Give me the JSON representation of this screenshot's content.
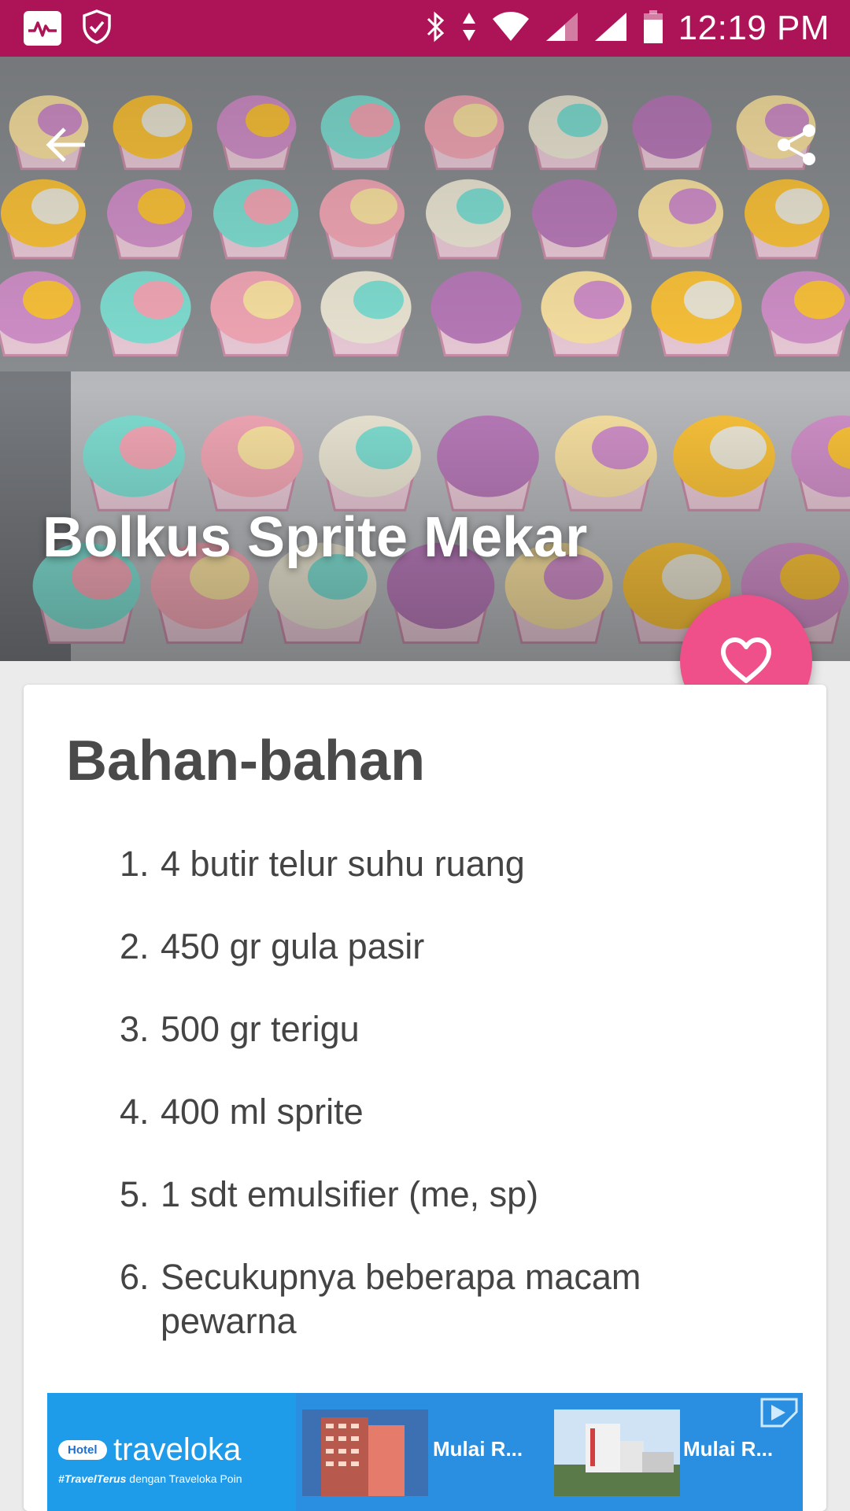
{
  "status_bar": {
    "time": "12:19 PM",
    "background_color": "#ad1457"
  },
  "hero": {
    "title": "Bolkus Sprite Mekar",
    "back_icon": "arrow-left-icon",
    "share_icon": "share-icon"
  },
  "fab": {
    "icon": "heart-outline-icon",
    "color": "#f0508a"
  },
  "ingredients": {
    "heading": "Bahan-bahan",
    "items": [
      {
        "number": "1.",
        "text": "4 butir telur suhu ruang"
      },
      {
        "number": "2.",
        "text": "450 gr gula pasir"
      },
      {
        "number": "3.",
        "text": "500 gr terigu"
      },
      {
        "number": "4.",
        "text": "400 ml sprite"
      },
      {
        "number": "5.",
        "text": "1 sdt emulsifier (me, sp)"
      },
      {
        "number": "6.",
        "text": "Secukupnya beberapa macam pewarna"
      }
    ]
  },
  "ad": {
    "badge": "Hotel",
    "brand": "traveloka",
    "tag_bold": "#TravelTerus",
    "tag_rest": " dengan Traveloka Poin",
    "cta_1": "Mulai R...",
    "cta_2": "Mulai R..."
  }
}
